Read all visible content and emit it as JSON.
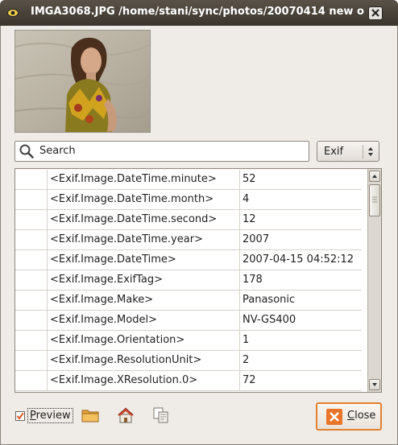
{
  "window": {
    "title": "IMGA3068.JPG /home/stani/sync/photos/20070414 new o"
  },
  "search": {
    "placeholder": "Search"
  },
  "filter": {
    "selected": "Exif"
  },
  "table": {
    "rows": [
      {
        "tag": "<Exif.Image.DateTime.minute>",
        "value": "52"
      },
      {
        "tag": "<Exif.Image.DateTime.month>",
        "value": "4"
      },
      {
        "tag": "<Exif.Image.DateTime.second>",
        "value": "12"
      },
      {
        "tag": "<Exif.Image.DateTime.year>",
        "value": "2007"
      },
      {
        "tag": "<Exif.Image.DateTime>",
        "value": "2007-04-15 04:52:12"
      },
      {
        "tag": "<Exif.Image.ExifTag>",
        "value": "178"
      },
      {
        "tag": "<Exif.Image.Make>",
        "value": "Panasonic"
      },
      {
        "tag": "<Exif.Image.Model>",
        "value": "NV-GS400"
      },
      {
        "tag": "<Exif.Image.Orientation>",
        "value": "1"
      },
      {
        "tag": "<Exif.Image.ResolutionUnit>",
        "value": "2"
      },
      {
        "tag": "<Exif.Image.XResolution.0>",
        "value": "72"
      }
    ]
  },
  "bottom": {
    "preview_label": "Preview",
    "preview_checked": true,
    "close_label": "Close"
  },
  "colors": {
    "titlebar": "#3f3933",
    "accent": "#e0822f"
  },
  "icons": [
    "eye-icon",
    "window-close-icon",
    "search-icon",
    "folder-icon",
    "home-icon",
    "copy-icon",
    "close-icon"
  ]
}
